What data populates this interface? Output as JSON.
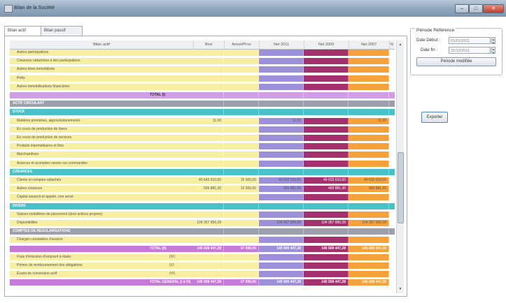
{
  "window": {
    "title": "Bilan de la Société"
  },
  "tabs": [
    {
      "label": "Bilan actif"
    },
    {
      "label": "Bilan passif"
    }
  ],
  "columns": [
    "Bilan actif",
    "Brut",
    "Amort/Prov",
    "Net 2011",
    "Net 2009",
    "Net 2007",
    "%"
  ],
  "colors": {
    "col_net2011": "#9b90d9",
    "col_net2009": "#a4306e",
    "col_net2007": "#f5a23a",
    "row_yellow": "#f7eea2",
    "row_total": "#cf9ee4",
    "row_section": "#9ca0ad",
    "row_sub": "#48c2c8",
    "row_total2": "#c679d8"
  },
  "rows": [
    {
      "label": "Autres participations",
      "type": "normal",
      "brut": "",
      "amort": "",
      "n1": "",
      "n2": "",
      "n3": ""
    },
    {
      "label": "Créances rattachées à des participations",
      "type": "normal",
      "brut": "",
      "amort": "",
      "n1": "",
      "n2": "",
      "n3": ""
    },
    {
      "label": "Autres titres immobilisés",
      "type": "normal",
      "brut": "",
      "amort": "",
      "n1": "",
      "n2": "",
      "n3": ""
    },
    {
      "label": "Prêts",
      "type": "normal",
      "brut": "",
      "amort": "",
      "n1": "",
      "n2": "",
      "n3": ""
    },
    {
      "label": "Autres immobilisations financières",
      "type": "normal",
      "brut": "",
      "amort": "",
      "n1": "",
      "n2": "",
      "n3": ""
    },
    {
      "label": "TOTAL (I)",
      "type": "total",
      "brut": "",
      "amort": "",
      "n1": "",
      "n2": "",
      "n3": ""
    },
    {
      "label": "ACTIF CIRCULANT",
      "type": "section",
      "brut": "",
      "amort": "",
      "n1": "",
      "n2": "",
      "n3": ""
    },
    {
      "label": "STOCK",
      "type": "sub",
      "brut": "",
      "amort": "",
      "n1": "",
      "n2": "",
      "n3": ""
    },
    {
      "label": "Matières premières, approvisionnements",
      "type": "normal",
      "brut": "11,00",
      "amort": "",
      "n1": "11,00",
      "n2": "",
      "n3": "11,00"
    },
    {
      "label": "En cours de production de biens",
      "type": "normal",
      "brut": "",
      "amort": "",
      "n1": "",
      "n2": "",
      "n3": ""
    },
    {
      "label": "En cours de production de services",
      "type": "normal",
      "brut": "",
      "amort": "",
      "n1": "",
      "n2": "",
      "n3": ""
    },
    {
      "label": "Produits intermédiaires et finis",
      "type": "normal",
      "brut": "",
      "amort": "",
      "n1": "",
      "n2": "",
      "n3": ""
    },
    {
      "label": "Marchandises",
      "type": "normal",
      "brut": "",
      "amort": "",
      "n1": "",
      "n2": "",
      "n3": ""
    },
    {
      "label": "Avances et acomptes versés sur commandes",
      "type": "normal",
      "brut": "",
      "amort": "",
      "n1": "",
      "n2": "",
      "n3": ""
    },
    {
      "label": "CREANCES",
      "type": "sub",
      "brut": "",
      "amort": "",
      "n1": "",
      "n2": "",
      "n3": ""
    },
    {
      "label": "Clients et comptes rattachés",
      "type": "normal",
      "brut": "40 643 610,50",
      "amort": "15 000,00",
      "n1": "40 633 610,50",
      "n2": "40 633 610,50",
      "n3": "40 633 610,50"
    },
    {
      "label": "Autres créances",
      "type": "normal",
      "brut": "506 881,30",
      "amort": "12 000,00",
      "n1": "493 881,30",
      "n2": "493 881,30",
      "n3": "493 881,30"
    },
    {
      "label": "Capital souscrit et appelé, non versé",
      "type": "normal",
      "brut": "",
      "amort": "",
      "n1": "",
      "n2": "",
      "n3": ""
    },
    {
      "label": "DIVERS",
      "type": "sub",
      "brut": "",
      "amort": "",
      "n1": "",
      "n2": "",
      "n3": ""
    },
    {
      "label": "Valeurs mobilières de placement (dont actions propres)",
      "type": "normal",
      "brut": "",
      "amort": "",
      "n1": "",
      "n2": "",
      "n3": ""
    },
    {
      "label": "Disponibilités",
      "type": "normal",
      "brut": "104 357 956,28",
      "amort": "",
      "n1": "104 357 956,28",
      "n2": "104 357 956,28",
      "n3": "104 357 956,28"
    },
    {
      "label": "COMPTES DE REGULARISATIONS",
      "type": "section",
      "brut": "",
      "amort": "",
      "n1": "",
      "n2": "",
      "n3": ""
    },
    {
      "label": "Charges constatées d'avance",
      "type": "normal",
      "brut": "",
      "amort": "",
      "n1": "",
      "n2": "",
      "n3": ""
    },
    {
      "label": "TOTAL (II)",
      "type": "total2",
      "brut": "145 509 447,28",
      "amort": "27 000,00",
      "n1": "145 509 447,28",
      "n2": "145 509 447,28",
      "n3": "145 509 447,28"
    },
    {
      "label": "Frais d'émission d'emprunt à étaler",
      "code": "(IV)",
      "type": "normal",
      "brut": "",
      "amort": "",
      "n1": "",
      "n2": "",
      "n3": ""
    },
    {
      "label": "Primes de remboursement des obligations",
      "code": "(V)",
      "type": "normal",
      "brut": "",
      "amort": "",
      "n1": "",
      "n2": "",
      "n3": ""
    },
    {
      "label": "Écarts de conversion actif",
      "code": "(VI)",
      "type": "normal",
      "brut": "",
      "amort": "",
      "n1": "",
      "n2": "",
      "n3": ""
    },
    {
      "label": "TOTAL GENERAL (I à VI)",
      "type": "total2",
      "brut": "145 509 447,28",
      "amort": "27 000,00",
      "n1": "145 509 447,28",
      "n2": "145 509 447,28",
      "n3": "145 509 447,28"
    }
  ],
  "period": {
    "legend": "Période Référence",
    "start_label": "Date Début :",
    "start_value": "01/01/2011",
    "end_label": "Date fin :",
    "end_value": "31/12/2011",
    "modify_label": "Période modifiée"
  },
  "export_label": "Exporter"
}
